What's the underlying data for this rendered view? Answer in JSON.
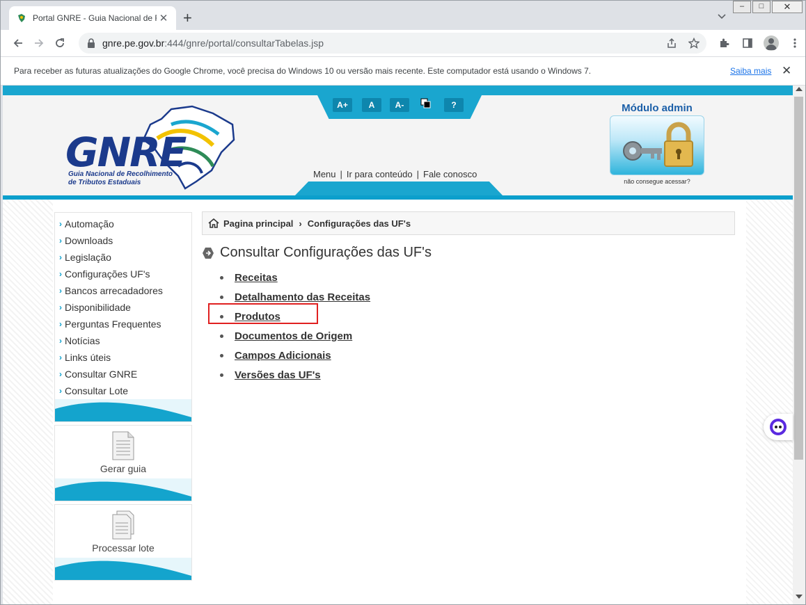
{
  "browser": {
    "tab_title": "Portal GNRE - Guia Nacional de Recolhimento",
    "tab_close": "✕",
    "newtab": "+",
    "url_host": "gnre.pe.gov.br",
    "url_path": ":444/gnre/portal/consultarTabelas.jsp",
    "infobar_text": "Para receber as futuras atualizações do Google Chrome, você precisa do Windows 10 ou versão mais recente. Este computador está usando o Windows 7.",
    "infobar_link": "Saiba mais",
    "infobar_close": "✕",
    "win_min": "–",
    "win_max": "□",
    "win_close": "✕"
  },
  "header": {
    "a11y": {
      "increase": "A+",
      "normal": "A",
      "decrease": "A-",
      "help": "?"
    },
    "logo_text": "GNRE",
    "logo_sub1": "Guia Nacional de Recolhimento",
    "logo_sub2": "de Tributos Estaduais",
    "links": {
      "menu": "Menu",
      "content": "Ir para conteúdo",
      "contact": "Fale conosco",
      "sep": "|"
    },
    "admin_title": "Módulo admin",
    "admin_help": "não consegue acessar?"
  },
  "sidebar": {
    "items": [
      {
        "label": "Automação"
      },
      {
        "label": "Downloads"
      },
      {
        "label": "Legislação"
      },
      {
        "label": "Configurações UF's"
      },
      {
        "label": "Bancos arrecadadores"
      },
      {
        "label": "Disponibilidade"
      },
      {
        "label": "Perguntas Frequentes"
      },
      {
        "label": "Notícias"
      },
      {
        "label": "Links úteis"
      },
      {
        "label": "Consultar GNRE"
      },
      {
        "label": "Consultar Lote"
      }
    ],
    "card1": "Gerar guia",
    "card2": "Processar lote"
  },
  "main": {
    "breadcrumb": {
      "home": "Pagina principal",
      "current": "Configurações das UF's",
      "sep": "›"
    },
    "title": "Consultar Configurações das UF's",
    "links": [
      {
        "label": "Receitas"
      },
      {
        "label": "Detalhamento das Receitas"
      },
      {
        "label": "Produtos"
      },
      {
        "label": "Documentos de Origem"
      },
      {
        "label": "Campos Adicionais"
      },
      {
        "label": "Versões das UF's"
      }
    ]
  },
  "colors": {
    "accent": "#1aa6cf",
    "brand": "#1b3a8c",
    "highlight": "#e02020"
  }
}
